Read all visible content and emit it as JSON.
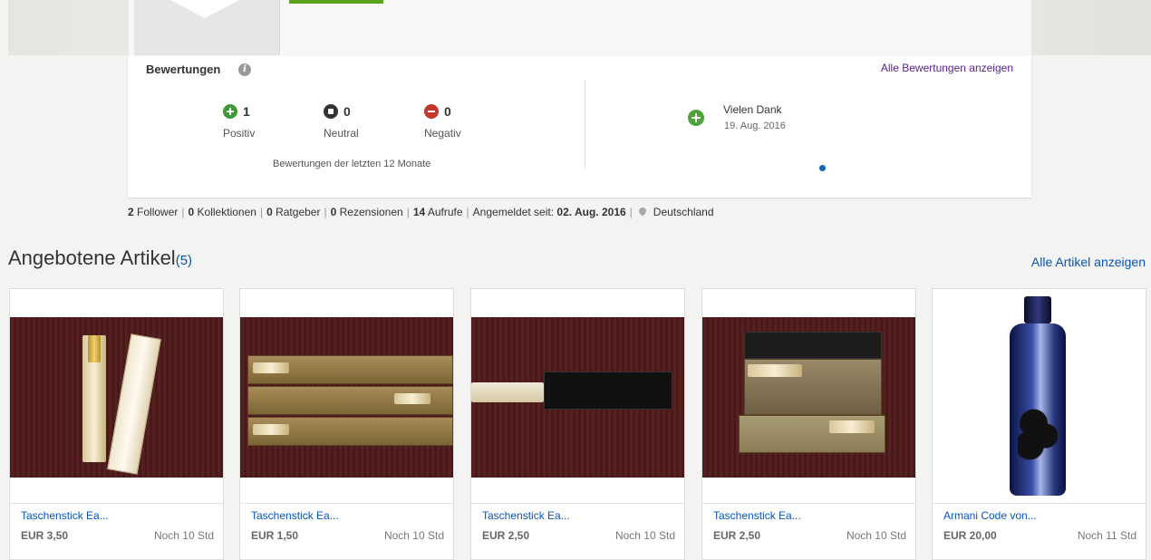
{
  "feedback": {
    "title": "Bewertungen",
    "all_link": "Alle Bewertungen anzeigen",
    "positive": {
      "count": "1",
      "label": "Positiv"
    },
    "neutral": {
      "count": "0",
      "label": "Neutral"
    },
    "negative": {
      "count": "0",
      "label": "Negativ"
    },
    "period": "Bewertungen der letzten 12 Monate",
    "latest": {
      "text": "Vielen Dank",
      "date": "19. Aug. 2016"
    }
  },
  "stats": {
    "followers": "2",
    "followers_label": "Follower",
    "collections": "0",
    "collections_label": "Kollektionen",
    "guides": "0",
    "guides_label": "Ratgeber",
    "reviews": "0",
    "reviews_label": "Rezensionen",
    "views": "14",
    "views_label": "Aufrufe",
    "member_since_label": "Angemeldet seit:",
    "member_since": "02. Aug. 2016",
    "country": "Deutschland"
  },
  "listings": {
    "title": "Angebotene Artikel",
    "count": "(5)",
    "all_link": "Alle Artikel anzeigen",
    "items": [
      {
        "title": "Taschenstick Ea...",
        "price": "EUR 3,50",
        "time": "Noch 10 Std"
      },
      {
        "title": "Taschenstick Ea...",
        "price": "EUR 1,50",
        "time": "Noch 10 Std"
      },
      {
        "title": "Taschenstick Ea...",
        "price": "EUR 2,50",
        "time": "Noch 10 Std"
      },
      {
        "title": "Taschenstick Ea...",
        "price": "EUR 2,50",
        "time": "Noch 10 Std"
      },
      {
        "title": "Armani Code von...",
        "price": "EUR 20,00",
        "time": "Noch 11 Std"
      }
    ]
  },
  "icons": {
    "info": "info-icon",
    "positive": "plus-circle-icon",
    "neutral": "square-circle-icon",
    "negative": "minus-circle-icon",
    "location": "location-pin-icon"
  },
  "colors": {
    "link": "#0654ba",
    "positive": "#3d9b35",
    "negative": "#c0392b",
    "visited_link": "#5a1f8b"
  }
}
